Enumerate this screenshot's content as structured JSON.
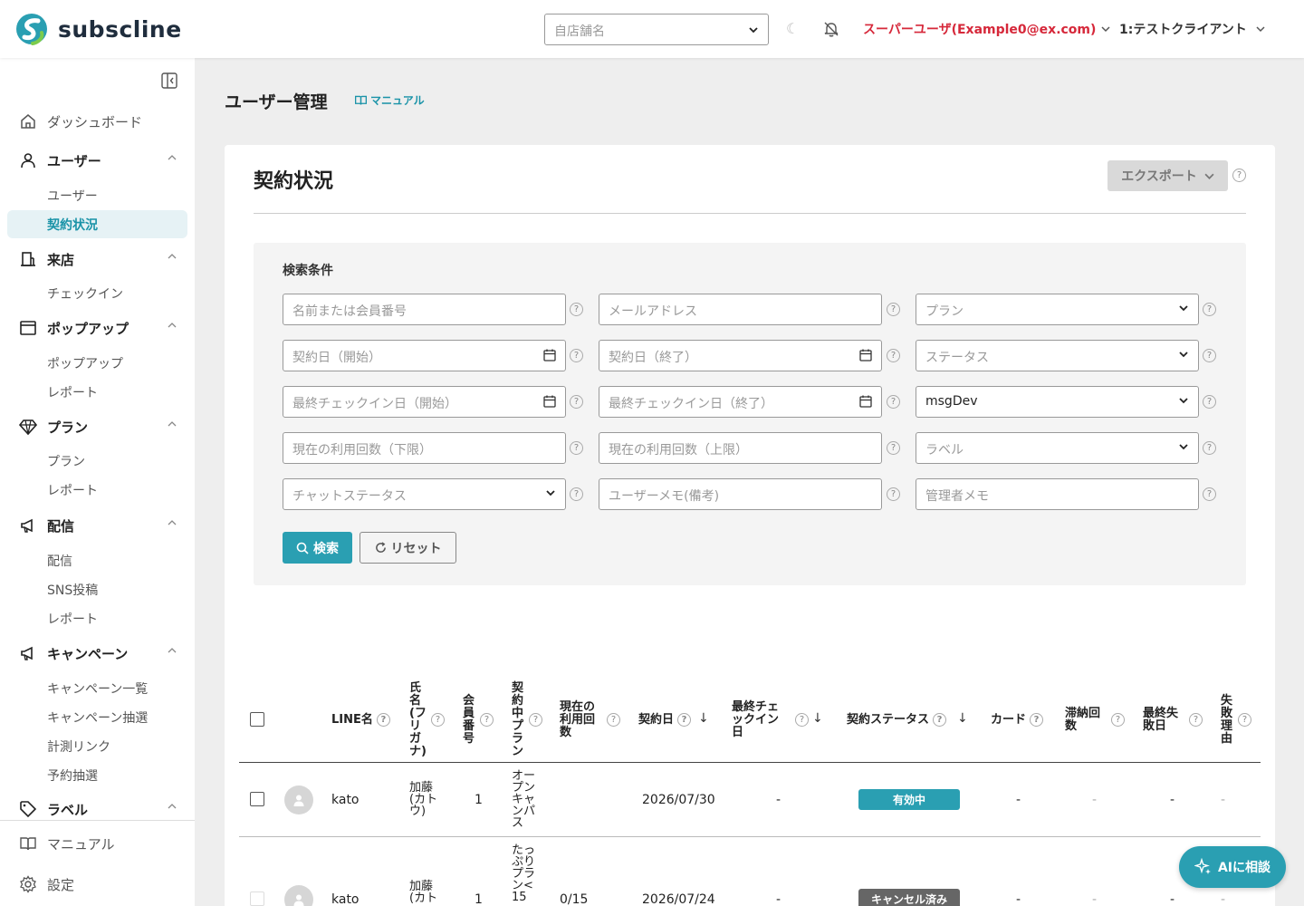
{
  "app": {
    "brand": "subscline",
    "accent": "#2a9fb2",
    "danger": "#d6283a"
  },
  "header": {
    "store_placeholder": "自店舗名",
    "user_label": "スーパーユーザ(Example0@ex.com)",
    "client_label": "1:テストクライアント"
  },
  "sidebar": {
    "dashboard": "ダッシュボード",
    "user_section": "ユーザー",
    "user_items": [
      "ユーザー",
      "契約状況"
    ],
    "visit_section": "来店",
    "visit_items": [
      "チェックイン"
    ],
    "popup_section": "ポップアップ",
    "popup_items": [
      "ポップアップ",
      "レポート"
    ],
    "plan_section": "プラン",
    "plan_items": [
      "プラン",
      "レポート"
    ],
    "delivery_section": "配信",
    "delivery_items": [
      "配信",
      "SNS投稿",
      "レポート"
    ],
    "campaign_section": "キャンペーン",
    "campaign_items": [
      "キャンペーン一覧",
      "キャンペーン抽選",
      "計測リンク",
      "予約抽選"
    ],
    "label_section": "ラベル",
    "manual": "マニュアル",
    "settings": "設定"
  },
  "page": {
    "title": "ユーザー管理",
    "manual_link": "マニュアル"
  },
  "card": {
    "title": "契約状況",
    "export_label": "エクスポート"
  },
  "search": {
    "title": "検索条件",
    "fields": [
      "名前または会員番号",
      "メールアドレス",
      "プラン",
      "契約日（開始）",
      "契約日（終了）",
      "ステータス",
      "最終チェックイン日（開始）",
      "最終チェックイン日（終了）",
      "msgDev",
      "現在の利用回数（下限）",
      "現在の利用回数（上限）",
      "ラベル",
      "チャットステータス",
      "ユーザーメモ(備考)",
      "管理者メモ"
    ],
    "search_label": "検索",
    "reset_label": "リセット"
  },
  "table": {
    "headers": {
      "line_name": "LINE名",
      "name_kana": "氏名(フリガナ)",
      "member_no": "会員番号",
      "plan": "契約中プラン",
      "usage": "現在の利用回数",
      "contract_date": "契約日",
      "last_checkin": "最終チェックイン日",
      "status": "契約ステータス",
      "card": "カード",
      "arrears": "滞納回数",
      "last_fail": "最終失敗日",
      "fail_reason": "失敗理由"
    },
    "rows": [
      {
        "line_name": "kato",
        "name_kana": "加藤(カトウ)",
        "member_no": "1",
        "plan": "オープンキャンパス",
        "usage": "",
        "contract_date": "2026/07/30",
        "last_checkin": "-",
        "status": "有効中",
        "status_color": "#2a9fb2",
        "card": "-",
        "arrears": "-",
        "last_fail": "-",
        "fail_reason": "-"
      },
      {
        "line_name": "kato",
        "name_kana": "加藤(カト",
        "member_no": "1",
        "plan": "たっぷりプラン<15",
        "usage": "0/15",
        "contract_date": "2026/07/24",
        "last_checkin": "-",
        "status": "キャンセル済み",
        "status_color": "#666666",
        "card": "-",
        "arrears": "-",
        "last_fail": "-",
        "fail_reason": "-"
      }
    ]
  },
  "ai_button": "AIに相談"
}
